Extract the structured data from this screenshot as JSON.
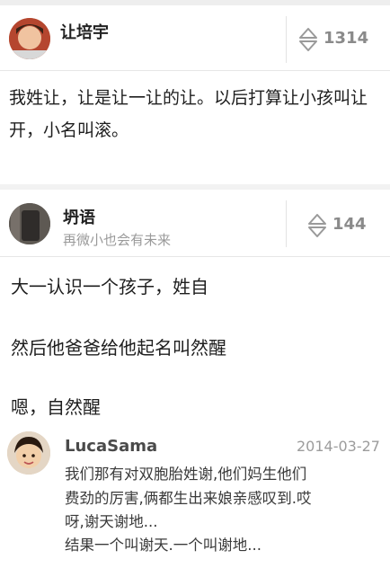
{
  "answer1": {
    "author": "让培宇",
    "votes": "1314",
    "content": "我姓让，让是让一让的让。以后打算让小孩叫让开，小名叫滚。"
  },
  "answer2": {
    "author": "坍语",
    "bio": "再微小也会有未来",
    "votes": "144",
    "paragraphs": [
      "大一认识一个孩子，姓自",
      "然后他爸爸给他起名叫然醒",
      "嗯，自然醒"
    ]
  },
  "comment": {
    "author": "LucaSama",
    "date": "2014-03-27",
    "lines": [
      "我们那有对双胞胎姓谢,他们妈生他们",
      "费劲的厉害,俩都生出来娘亲感叹到.哎",
      "呀,谢天谢地...",
      "结果一个叫谢天.一个叫谢地..."
    ]
  },
  "icons": {
    "vote": "up-down-arrows-icon"
  }
}
